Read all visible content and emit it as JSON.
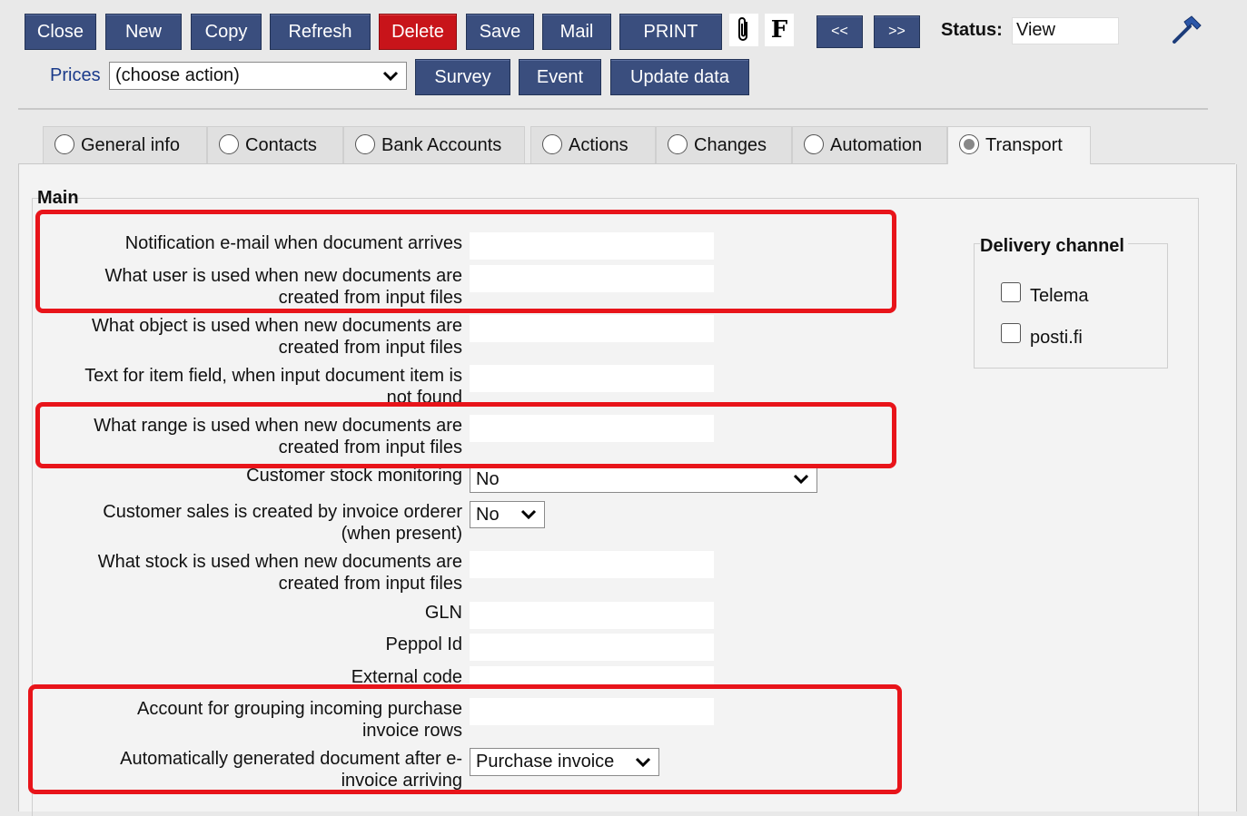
{
  "toolbar": {
    "close": "Close",
    "new": "New",
    "copy": "Copy",
    "refresh": "Refresh",
    "delete": "Delete",
    "save": "Save",
    "mail": "Mail",
    "print": "PRINT",
    "f_label": "F",
    "prev": "<<",
    "next": ">>",
    "status_label": "Status:",
    "status_value": "View"
  },
  "row2": {
    "prices_link": "Prices",
    "action_select": "(choose action)",
    "survey": "Survey",
    "event": "Event",
    "update": "Update data"
  },
  "tabs": [
    {
      "label": "General info",
      "selected": false
    },
    {
      "label": "Contacts",
      "selected": false
    },
    {
      "label": "Bank Accounts",
      "selected": false
    },
    {
      "label": "Actions",
      "selected": false
    },
    {
      "label": "Changes",
      "selected": false
    },
    {
      "label": "Automation",
      "selected": false
    },
    {
      "label": "Transport",
      "selected": true
    }
  ],
  "main": {
    "legend": "Main",
    "fields": {
      "notification_email": {
        "l1": "Notification e-mail when document arrives",
        "value": ""
      },
      "user_used": {
        "l1": "What user is used when new documents are",
        "l2": "created from input files",
        "value": ""
      },
      "object_used": {
        "l1": "What object is used when new documents are",
        "l2": "created from input files",
        "value": ""
      },
      "text_item": {
        "l1": "Text for item field, when input document item is",
        "l2": "not found",
        "value": ""
      },
      "range_used": {
        "l1": "What range is used when new documents are",
        "l2": "created from input files",
        "value": ""
      },
      "stock_monitoring": {
        "l1": "Customer stock monitoring",
        "value": "No"
      },
      "sales_orderer": {
        "l1": "Customer sales is created by invoice orderer",
        "l2": "(when present)",
        "value": "No"
      },
      "stock_used": {
        "l1": "What stock is used when new documents are",
        "l2": "created from input files",
        "value": ""
      },
      "gln": {
        "l1": "GLN",
        "value": ""
      },
      "peppol": {
        "l1": "Peppol Id",
        "value": ""
      },
      "external": {
        "l1": "External code",
        "value": ""
      },
      "grouping_account": {
        "l1": "Account for grouping incoming purchase",
        "l2": "invoice rows",
        "value": ""
      },
      "auto_doc": {
        "l1": "Automatically generated document after e-",
        "l2": "invoice arriving",
        "value": "Purchase invoice"
      }
    }
  },
  "delivery": {
    "legend": "Delivery channel",
    "options": [
      {
        "label": "Telema",
        "checked": false
      },
      {
        "label": "posti.fi",
        "checked": false
      }
    ]
  },
  "icons": {
    "attachment": "paperclip-icon",
    "tools": "hammer-icon",
    "dropdown": "chevron-down-icon"
  },
  "colors": {
    "button": "#3a4e7e",
    "delete": "#c8141a",
    "highlight": "#e8141a",
    "link": "#1a3a8a"
  }
}
